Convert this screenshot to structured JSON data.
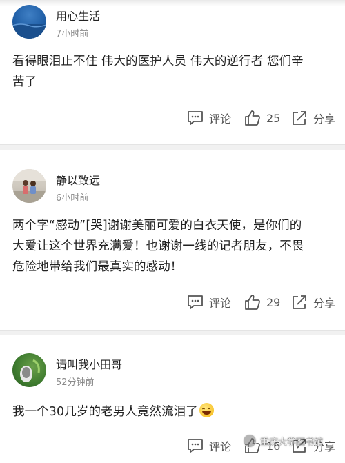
{
  "comments": [
    {
      "username": "用心生活",
      "time": "7小时前",
      "text_lines": [
        "看得眼泪止不住 伟大的医护人员 伟大的逆行者 您们辛",
        "苦了"
      ],
      "comment_label": "评论",
      "likes": "25",
      "share_label": "分享",
      "avatar_icon": "ocean-avatar"
    },
    {
      "username": "静以致远",
      "time": "6小时前",
      "text_lines": [
        "两个字“感动”[哭]谢谢美丽可爱的白衣天使，是你们的",
        "大爱让这个世界充满爱！也谢谢一线的记者朋友，不畏",
        "危险地带给我们最真实的感动！"
      ],
      "comment_label": "评论",
      "likes": "29",
      "share_label": "分享",
      "avatar_icon": "photo-avatar"
    },
    {
      "username": "请叫我小田哥",
      "time": "52分钟前",
      "text_lines": [
        "我一个30几岁的老男人竟然流泪了"
      ],
      "emoji": "grinning-face-emoji",
      "comment_label": "评论",
      "likes": "16",
      "share_label": "分享",
      "avatar_icon": "plant-avatar"
    }
  ],
  "watermark": "重庆大学图书馆",
  "colors": {
    "text": "#222222",
    "meta": "#8a8a8a",
    "action": "#555555",
    "divider": "#f1f1f1"
  }
}
